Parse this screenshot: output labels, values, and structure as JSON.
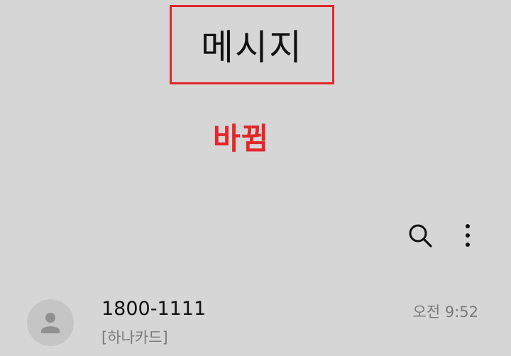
{
  "header": {
    "title": "메시지",
    "annotation": "바뀜"
  },
  "toolbar": {
    "search_icon": "search-icon",
    "more_icon": "more-vert-icon"
  },
  "conversations": [
    {
      "sender": "1800-1111",
      "preview": "[하나카드]",
      "time": "오전 9:52",
      "avatar_icon": "person-icon"
    }
  ],
  "colors": {
    "background": "#d6d6d6",
    "highlight": "#e3262a",
    "avatar_bg": "#c5c5c5"
  }
}
